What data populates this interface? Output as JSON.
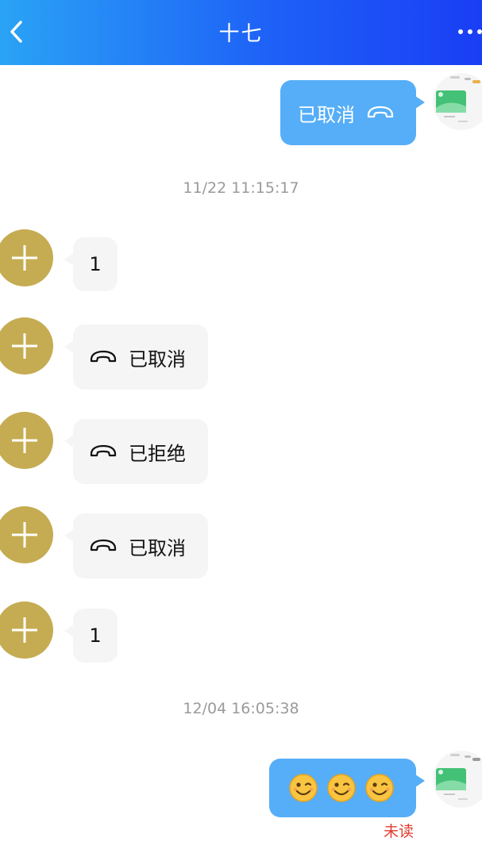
{
  "header": {
    "title": "十七",
    "back_icon": "chevron-left-icon",
    "more_icon": "more-dots-icon",
    "gradient": [
      "#2aa3f5",
      "#1a3ef5"
    ]
  },
  "colors": {
    "outgoing_bubble": "#55aef7",
    "incoming_bubble": "#f5f5f5",
    "other_avatar": "#c5ac52",
    "unread_label": "#e23b2e",
    "timestamp": "#9a9a9a"
  },
  "messages": [
    {
      "direction": "out",
      "type": "call",
      "text": "已取消",
      "icon": "hangup-phone-icon"
    },
    {
      "type": "timestamp",
      "text": "11/22 11:15:17"
    },
    {
      "direction": "in",
      "type": "text",
      "text": "1"
    },
    {
      "direction": "in",
      "type": "call",
      "text": "已取消",
      "icon": "hangup-phone-icon"
    },
    {
      "direction": "in",
      "type": "call",
      "text": "已拒绝",
      "icon": "hangup-phone-icon"
    },
    {
      "direction": "in",
      "type": "call",
      "text": "已取消",
      "icon": "hangup-phone-icon"
    },
    {
      "direction": "in",
      "type": "text",
      "text": "1"
    },
    {
      "type": "timestamp",
      "text": "12/04 16:05:38"
    },
    {
      "direction": "out",
      "type": "emoji",
      "emojis": [
        "wink-emoji-icon",
        "wink-emoji-icon",
        "wink-emoji-icon"
      ],
      "status": "未读"
    }
  ]
}
